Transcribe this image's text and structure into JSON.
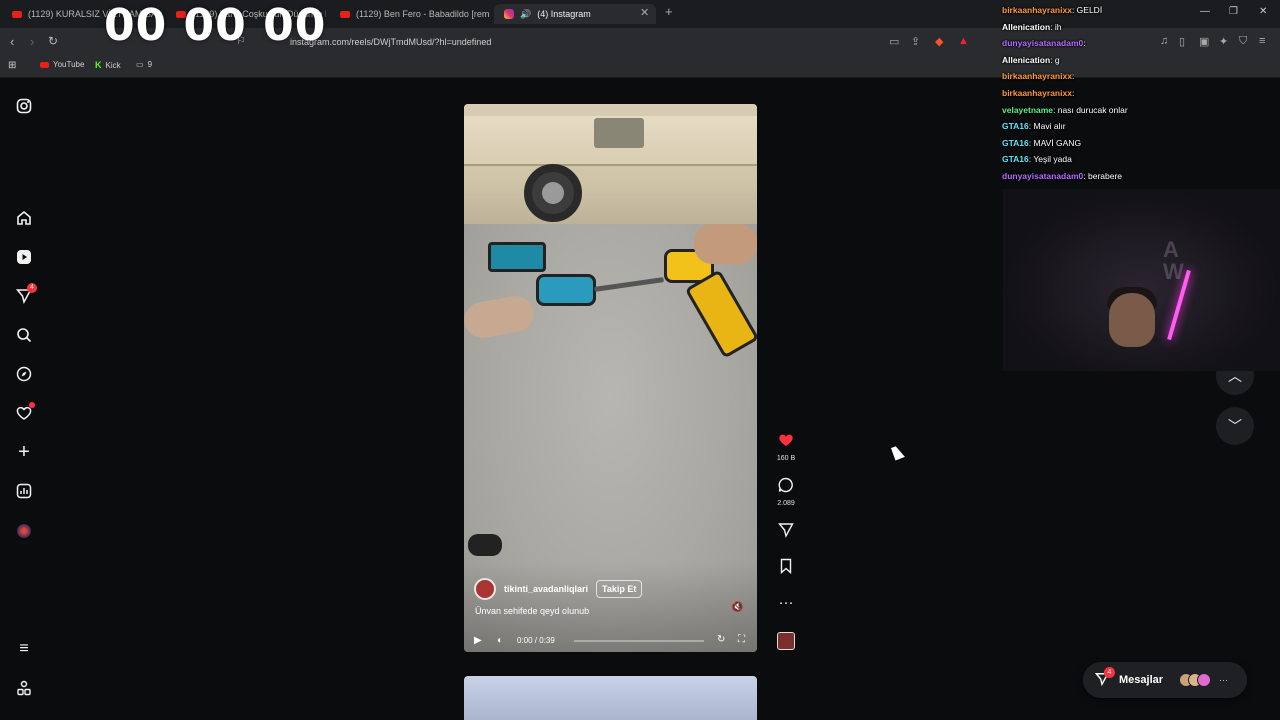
{
  "browser": {
    "tabs": [
      {
        "label": "(1129) KURALSIZ VİETNAM SAHİLİ..."
      },
      {
        "label": "(1129) Vahit Coşkun'un Düşünce M..."
      },
      {
        "label": "(1129) Ben Fero - Babadildo [remix b..."
      },
      {
        "label": "(4) Instagram"
      }
    ],
    "new_tab": "+",
    "url": "instagram.com/reels/DWjTmdMUsd/?hl=undefined",
    "bookmarks": [
      {
        "label": "YouTube"
      },
      {
        "label": "Kick"
      },
      {
        "label": "9"
      }
    ]
  },
  "timer": "00 00 00",
  "sidebar": {
    "notifications_badge": "4"
  },
  "reel": {
    "author": "tikinti_avadanliqlari",
    "follow_label": "Takip Et",
    "caption": "Ünvan sehifede qeyd olunub",
    "time": "0:00 / 0:39",
    "progress": 0.0
  },
  "actions": {
    "likes": "160 B",
    "comments": "2.089"
  },
  "chat": [
    {
      "user": "birkaanhayranixx",
      "color": "#ff9a3c",
      "message": "GELDİ"
    },
    {
      "user": "Allenication",
      "color": "#ffffff",
      "message": "ih"
    },
    {
      "user": "dunyayisatanadam0",
      "color": "#b56bff",
      "message": ""
    },
    {
      "user": "Allenication",
      "color": "#ffffff",
      "message": "g"
    },
    {
      "user": "birkaanhayranixx",
      "color": "#ff9a3c",
      "message": ""
    },
    {
      "user": "birkaanhayranixx",
      "color": "#ff9a3c",
      "message": ""
    },
    {
      "user": "velayetname",
      "color": "#5cf28a",
      "message": "nası durucak onlar"
    },
    {
      "user": "GTA16",
      "color": "#5ce8ff",
      "message": "Mavi alır"
    },
    {
      "user": "GTA16",
      "color": "#5ce8ff",
      "message": "MAVİ GANG"
    },
    {
      "user": "GTA16",
      "color": "#5ce8ff",
      "message": "Yeşil yada"
    },
    {
      "user": "dunyayisatanadam0",
      "color": "#b56bff",
      "message": "berabere"
    }
  ],
  "messages": {
    "label": "Mesajlar",
    "badge": "4"
  },
  "colors": {
    "like_red": "#ff3040",
    "page_bg": "#0b0c0e"
  }
}
